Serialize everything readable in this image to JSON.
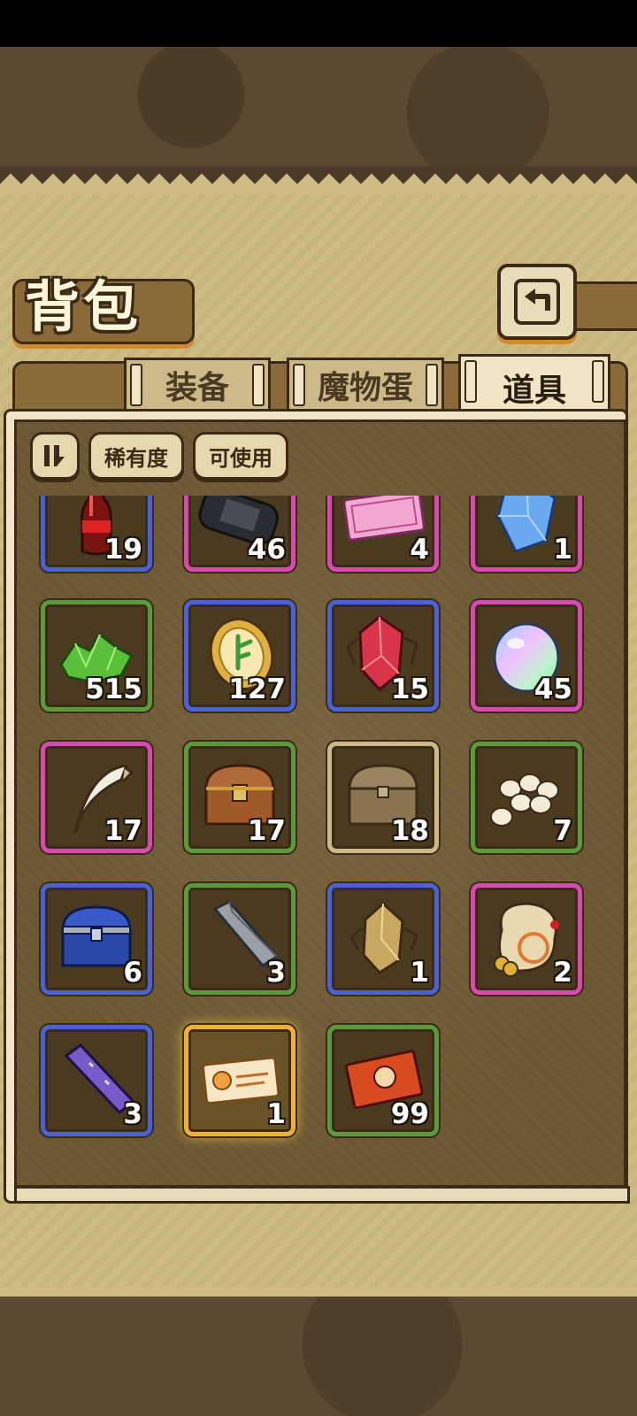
{
  "screen": {
    "title": "背包"
  },
  "tabs": [
    {
      "label": "装备",
      "active": false
    },
    {
      "label": "魔物蛋",
      "active": false
    },
    {
      "label": "道具",
      "active": true
    }
  ],
  "filters": {
    "sort_icon": "sort-toggle-icon",
    "rarity_label": "稀有度",
    "usable_label": "可使用"
  },
  "inventory": {
    "items": [
      {
        "icon": "cola-bottle-icon",
        "frame": "blue",
        "count": "19"
      },
      {
        "icon": "game-console-icon",
        "frame": "pink",
        "count": "46"
      },
      {
        "icon": "pink-ticket-icon",
        "frame": "pink",
        "count": "4"
      },
      {
        "icon": "blue-crystal-icon",
        "frame": "pink",
        "count": "1"
      },
      {
        "icon": "green-crystals-icon",
        "frame": "green",
        "count": "515"
      },
      {
        "icon": "gold-coin-icon",
        "frame": "blue",
        "count": "127"
      },
      {
        "icon": "red-crystal-icon",
        "frame": "blue",
        "count": "15"
      },
      {
        "icon": "rainbow-egg-icon",
        "frame": "pink",
        "count": "45"
      },
      {
        "icon": "fang-claw-icon",
        "frame": "pink",
        "count": "17"
      },
      {
        "icon": "wooden-chest-icon",
        "frame": "green",
        "count": "17"
      },
      {
        "icon": "plain-chest-icon",
        "frame": "tan",
        "count": "18"
      },
      {
        "icon": "eggs-pile-icon",
        "frame": "green",
        "count": "7"
      },
      {
        "icon": "blue-chest-icon",
        "frame": "blue",
        "count": "6"
      },
      {
        "icon": "iron-bar-icon",
        "frame": "green",
        "count": "3"
      },
      {
        "icon": "gold-ore-icon",
        "frame": "blue",
        "count": "1"
      },
      {
        "icon": "treasure-sack-icon",
        "frame": "pink",
        "count": "2"
      },
      {
        "icon": "purple-bar-icon",
        "frame": "blue",
        "count": "3"
      },
      {
        "icon": "gold-ticket-icon",
        "frame": "gold",
        "count": "1"
      },
      {
        "icon": "red-card-icon",
        "frame": "green",
        "count": "99"
      }
    ]
  },
  "colors": {
    "frame_blue": "#4a62d8",
    "frame_pink": "#d84ab0",
    "frame_green": "#5a9a3a",
    "frame_tan": "#cbb98a",
    "frame_gold": "#f0b030",
    "panel_bg": "#6f5a36"
  }
}
